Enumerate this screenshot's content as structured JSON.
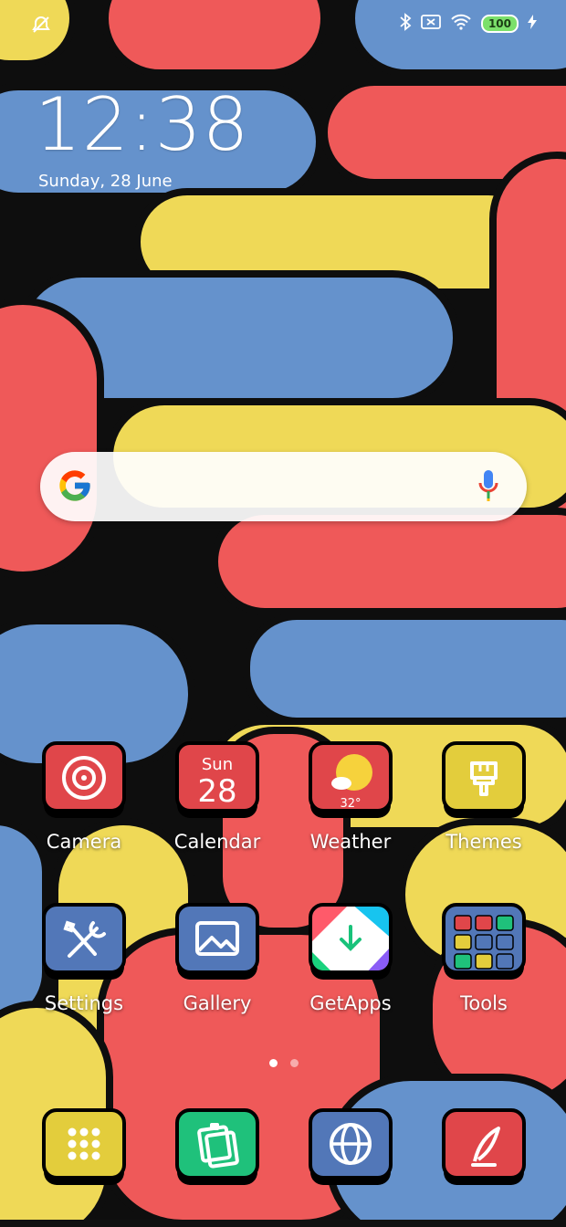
{
  "status_bar": {
    "icons_left": [
      "alarm-off-icon"
    ],
    "icons_right": [
      "bluetooth-icon",
      "no-sim-icon",
      "wifi-icon",
      "battery-icon",
      "charging-icon"
    ],
    "battery": "100"
  },
  "clock": {
    "time": "12:38",
    "date": "Sunday, 28 June"
  },
  "search": {
    "left_icon": "google-icon",
    "right_icon": "microphone-icon"
  },
  "apps": [
    {
      "label": "Camera",
      "icon": "camera-icon",
      "color": "#e0464a"
    },
    {
      "label": "Calendar",
      "icon": "calendar-icon",
      "color": "#e0464a",
      "day_name": "Sun",
      "day_number": "28"
    },
    {
      "label": "Weather",
      "icon": "weather-icon",
      "color": "#e0464a",
      "temp": "32°"
    },
    {
      "label": "Themes",
      "icon": "paintbrush-icon",
      "color": "#e3cd3c"
    },
    {
      "label": "Settings",
      "icon": "tools-icon",
      "color": "#5277b8"
    },
    {
      "label": "Gallery",
      "icon": "image-icon",
      "color": "#5277b8"
    },
    {
      "label": "GetApps",
      "icon": "getapps-icon",
      "color": "#ffffff"
    },
    {
      "label": "Tools",
      "icon": "folder-icon",
      "color": "#5277b8"
    }
  ],
  "page_indicator": {
    "pages": 2,
    "current": 1
  },
  "dock": [
    {
      "icon": "app-drawer-icon",
      "color": "#e3cd3c"
    },
    {
      "icon": "notes-icon",
      "color": "#1fc17b"
    },
    {
      "icon": "browser-globe-icon",
      "color": "#5277b8"
    },
    {
      "icon": "feather-pen-icon",
      "color": "#e0464a"
    }
  ]
}
